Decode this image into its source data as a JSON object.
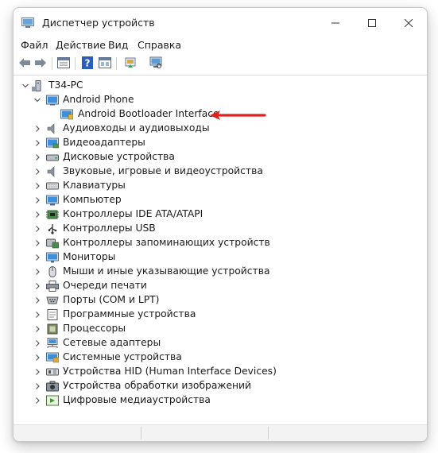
{
  "window": {
    "title": "Диспетчер устройств"
  },
  "menu": [
    "Файл",
    "Действие",
    "Вид",
    "Справка"
  ],
  "toolbar": {
    "buttons": [
      "back-icon",
      "forward-icon",
      "properties-icon",
      "help-icon",
      "view-icon",
      "update-driver-icon",
      "scan-hardware-icon"
    ]
  },
  "tree": {
    "root": "T34-PC",
    "expanded_category": "Android Phone",
    "expanded_child": "Android Bootloader Interface",
    "categories": [
      "Аудиовходы и аудиовыходы",
      "Видеоадаптеры",
      "Дисковые устройства",
      "Звуковые, игровые и видеоустройства",
      "Клавиатуры",
      "Компьютер",
      "Контроллеры IDE ATA/ATAPI",
      "Контроллеры USB",
      "Контроллеры запоминающих устройств",
      "Мониторы",
      "Мыши и иные указывающие устройства",
      "Очереди печати",
      "Порты (COM и LPT)",
      "Программные устройства",
      "Процессоры",
      "Сетевые адаптеры",
      "Системные устройства",
      "Устройства HID (Human Interface Devices)",
      "Устройства обработки изображений",
      "Цифровые медиаустройства"
    ]
  },
  "colors": {
    "accent": "#2b6cc4",
    "arrow": "#e0201c"
  }
}
